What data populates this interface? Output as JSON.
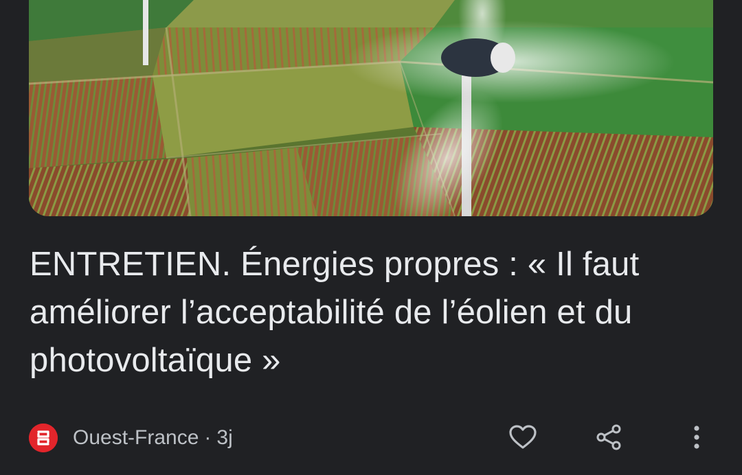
{
  "article": {
    "headline": "ENTRETIEN. Énergies propres : « Il faut améliorer l’acceptabilité de l’éolien et du photovoltaïque »",
    "image_icon": "wind-turbines-photo"
  },
  "source": {
    "name": "Ouest-France",
    "separator": "·",
    "age": "3j",
    "logo_color": "#e2252b"
  },
  "actions": {
    "like_icon": "heart-icon",
    "share_icon": "share-icon",
    "more_icon": "more-vert-icon"
  },
  "colors": {
    "background": "#202124",
    "headline": "#e8eaed",
    "meta": "#bdc1c6"
  }
}
